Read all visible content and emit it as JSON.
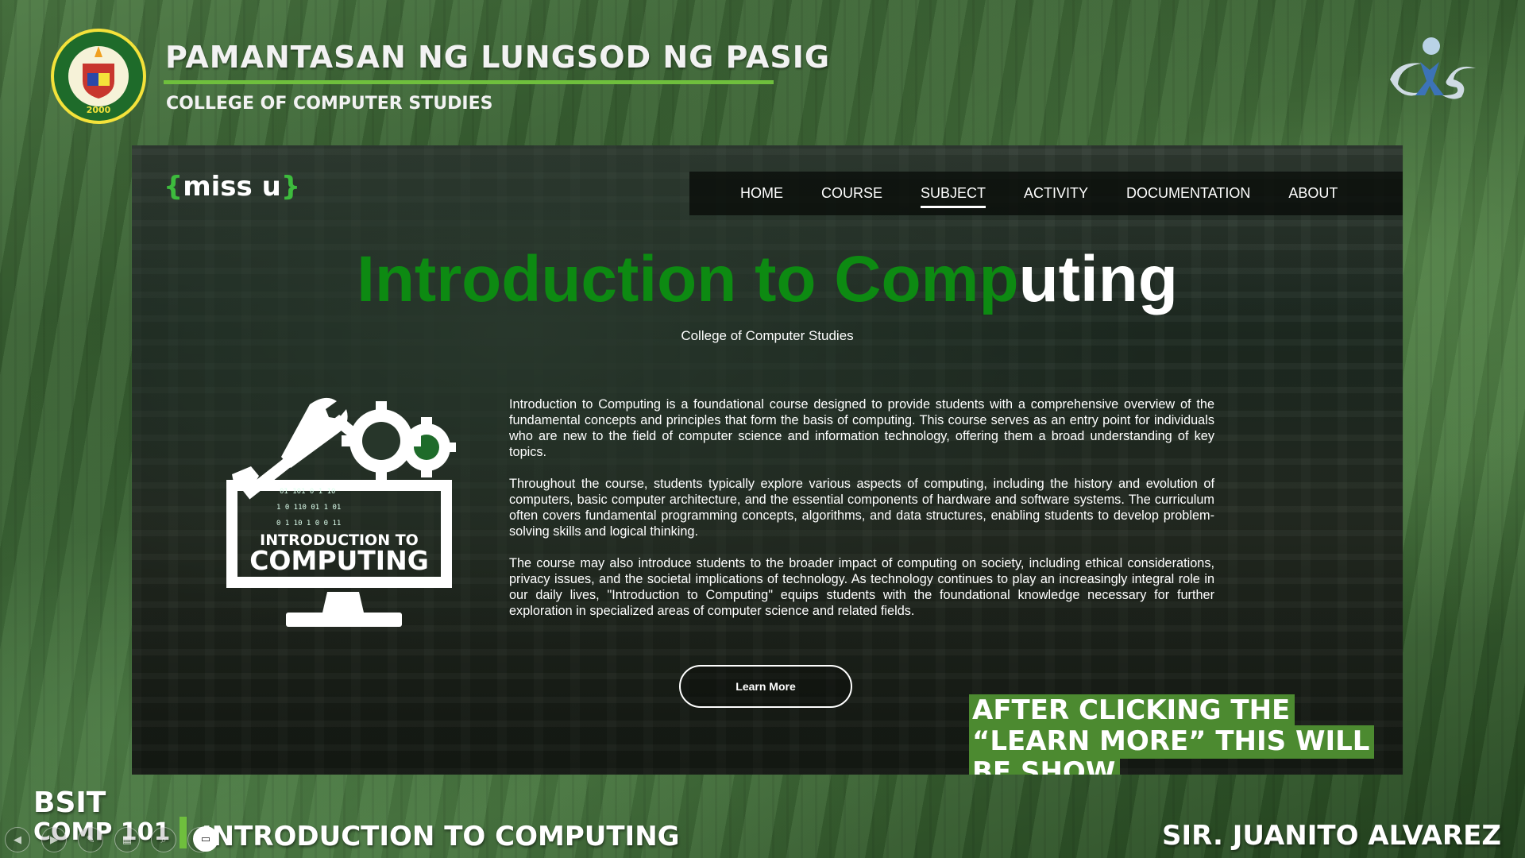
{
  "slide": {
    "university": "PAMANTASAN NG LUNGSOD NG PASIG",
    "college": "COLLEGE OF COMPUTER STUDIES",
    "seal_text_top": "PAMANTASAN NG LUNGSOD NG PASIG",
    "seal_year": "2000",
    "program": "BSIT",
    "course_code": "COMP 101",
    "course_title": "INTRODUCTION TO COMPUTING",
    "teacher": "SIR. JUANITO ALVAREZ"
  },
  "site": {
    "brand_open": "{",
    "brand_text": "miss u",
    "brand_close": "}",
    "nav": [
      {
        "label": "HOME",
        "active": false
      },
      {
        "label": "COURSE",
        "active": false
      },
      {
        "label": "SUBJECT",
        "active": true
      },
      {
        "label": "ACTIVITY",
        "active": false
      },
      {
        "label": "DOCUMENTATION",
        "active": false
      },
      {
        "label": "ABOUT",
        "active": false
      }
    ],
    "title_green": "Introduction to Comp",
    "title_white": "uting",
    "subtitle": "College of Computer Studies",
    "art_line1": "INTRODUCTION TO",
    "art_line2": "COMPUTING",
    "paragraphs": [
      "Introduction to Computing is a foundational course designed to provide students with a comprehensive overview of the fundamental concepts and principles that form the basis of computing. This course serves as an entry point for individuals who are new to the field of computer science and information technology, offering them a broad understanding of key topics.",
      "Throughout the course, students typically explore various aspects of computing, including the history and evolution of computers, basic computer architecture, and the essential components of hardware and software systems. The curriculum often covers fundamental programming concepts, algorithms, and data structures, enabling students to develop problem-solving skills and logical thinking.",
      "The course may also introduce students to the broader impact of computing on society, including ethical considerations, privacy issues, and the societal implications of technology. As technology continues to play an increasingly integral role in our daily lives, \"Introduction to Computing\" equips students with the foundational knowledge necessary for further exploration in specialized areas of computer science and related fields."
    ],
    "learn_more": "Learn More"
  },
  "callout": "AFTER CLICKING THE “LEARN MORE” THIS WILL BE SHOW",
  "colors": {
    "accent_green": "#6fbf3d",
    "title_green": "#0d8a12",
    "callout_bg": "#4c8a30"
  },
  "icons": [
    "university-seal-icon",
    "ccs-logo-icon",
    "computing-gear-icon",
    "prev-icon",
    "next-icon",
    "pen-icon",
    "slides-icon",
    "zoom-icon",
    "record-icon",
    "more-icon"
  ]
}
